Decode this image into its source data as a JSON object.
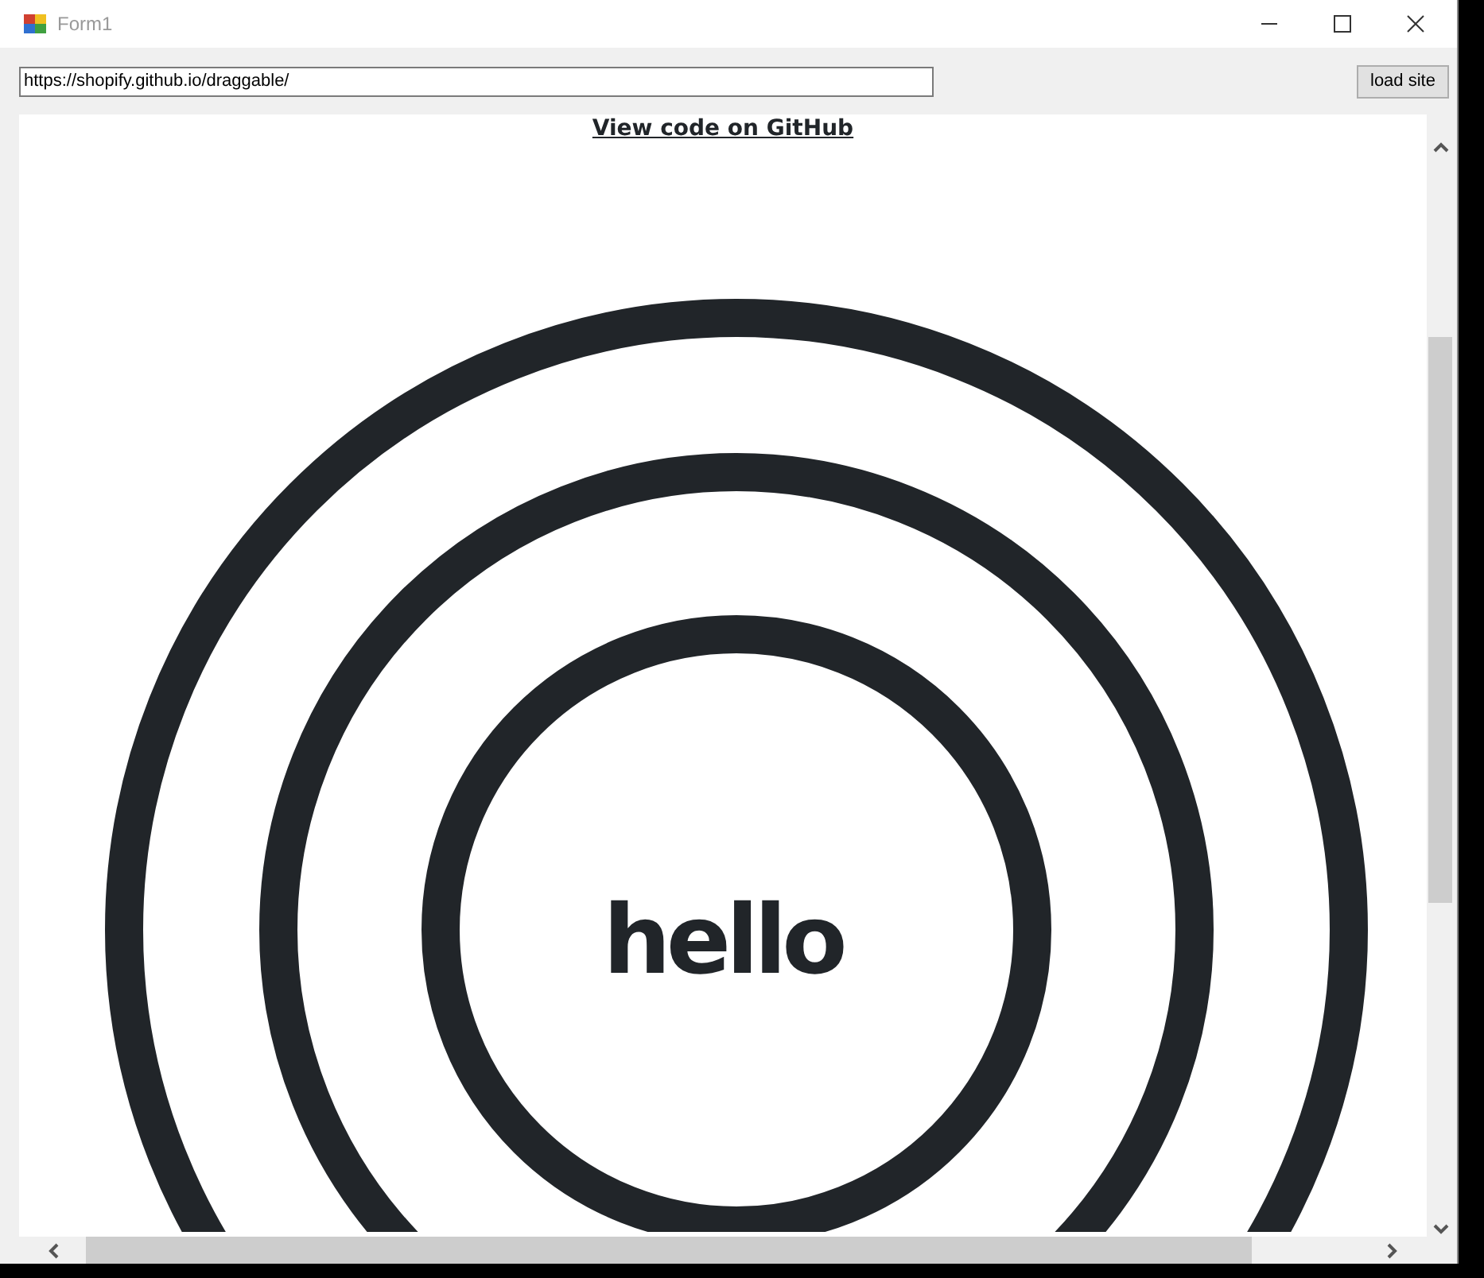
{
  "window": {
    "title": "Form1"
  },
  "address_bar": {
    "value": "https://shopify.github.io/draggable/"
  },
  "load_button": {
    "label": "load site"
  },
  "page": {
    "link": "View code on GitHub",
    "heading": "hello"
  }
}
